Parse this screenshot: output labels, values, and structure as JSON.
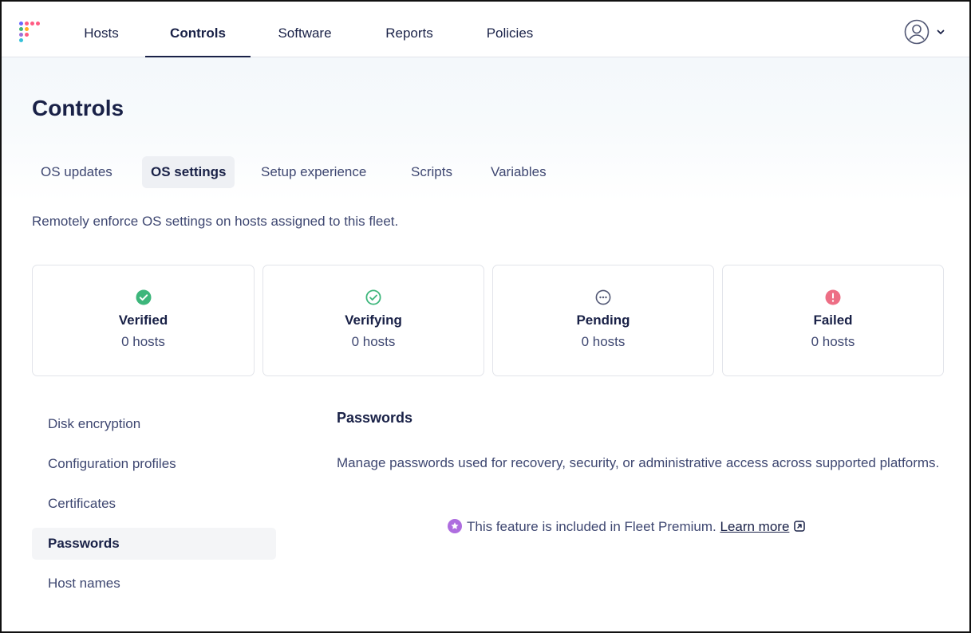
{
  "nav": {
    "items": [
      {
        "label": "Hosts"
      },
      {
        "label": "Controls",
        "active": true
      },
      {
        "label": "Software"
      },
      {
        "label": "Reports"
      },
      {
        "label": "Policies"
      }
    ],
    "logo_colors": [
      "#6a67fe",
      "#ff5c83",
      "#3db67b",
      "#ffb020",
      "#4fd061",
      "#9d71d8",
      "#36c1d9"
    ]
  },
  "page": {
    "title": "Controls",
    "tabs": [
      {
        "label": "OS updates"
      },
      {
        "label": "OS settings",
        "active": true
      },
      {
        "label": "Setup experience"
      },
      {
        "label": "Scripts"
      },
      {
        "label": "Variables"
      }
    ],
    "description": "Remotely enforce OS settings on hosts assigned to this fleet."
  },
  "status_cards": [
    {
      "label": "Verified",
      "count": "0 hosts",
      "icon": "check-filled-icon",
      "color": "#3db67b"
    },
    {
      "label": "Verifying",
      "count": "0 hosts",
      "icon": "check-outline-icon",
      "color": "#3db67b"
    },
    {
      "label": "Pending",
      "count": "0 hosts",
      "icon": "pending-icon",
      "color": "#515774"
    },
    {
      "label": "Failed",
      "count": "0 hosts",
      "icon": "error-icon",
      "color": "#ed6e85"
    }
  ],
  "sidebar": {
    "items": [
      {
        "label": "Disk encryption"
      },
      {
        "label": "Configuration profiles"
      },
      {
        "label": "Certificates"
      },
      {
        "label": "Passwords",
        "active": true
      },
      {
        "label": "Host names"
      }
    ]
  },
  "section": {
    "title": "Passwords",
    "description": "Manage passwords used for recovery, security, or administrative access across supported platforms.",
    "premium_text": "This feature is included in Fleet Premium.",
    "learn_more": "Learn more",
    "premium_color": "#ae6ddf"
  },
  "colors": {
    "text_primary": "#192147",
    "text_secondary": "#3e4771",
    "border": "#e2e4ea"
  }
}
